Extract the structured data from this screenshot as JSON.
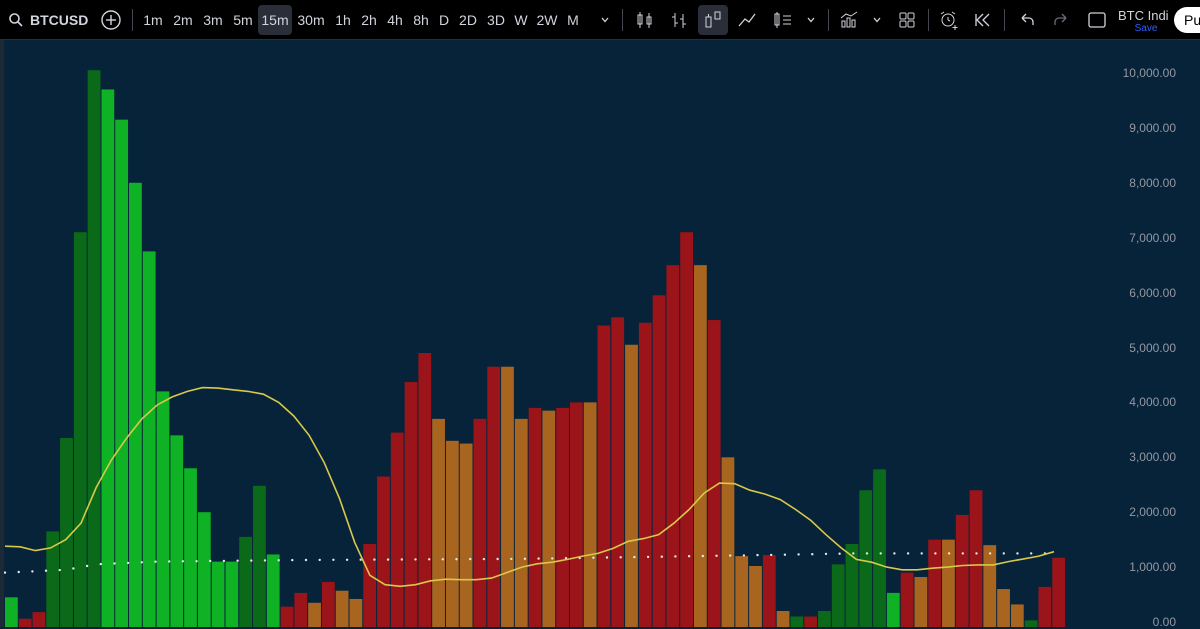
{
  "toolbar": {
    "symbol": "BTCUSD",
    "intervals": [
      "1m",
      "2m",
      "3m",
      "5m",
      "15m",
      "30m",
      "1h",
      "2h",
      "4h",
      "8h",
      "D",
      "2D",
      "3D",
      "W",
      "2W",
      "M"
    ],
    "active_interval": "15m",
    "layout_name": "BTC Indi",
    "save_status": "Save",
    "publish_label": "Pu"
  },
  "colors": {
    "background": "#06233a",
    "bright_green": "#0fb224",
    "dark_green": "#0b6a1a",
    "red": "#9b1419",
    "orange": "#a8651f",
    "ma_line": "#d8c94a",
    "dot_line": "#e8e8e8"
  },
  "chart_data": {
    "type": "bar",
    "ylim": [
      0,
      10000
    ],
    "y_ticks": [
      "10,000.00",
      "9,000.00",
      "8,000.00",
      "7,000.00",
      "6,000.00",
      "5,000.00",
      "4,000.00",
      "3,000.00",
      "2,000.00",
      "1,000.00",
      "0.00"
    ],
    "y_tick_values": [
      10000,
      9000,
      8000,
      7000,
      6000,
      5000,
      4000,
      3000,
      2000,
      1000,
      0
    ],
    "bars": [
      {
        "v": 450,
        "c": "bright_green"
      },
      {
        "v": 60,
        "c": "red"
      },
      {
        "v": 180,
        "c": "red"
      },
      {
        "v": 1650,
        "c": "dark_green"
      },
      {
        "v": 3350,
        "c": "dark_green"
      },
      {
        "v": 7100,
        "c": "dark_green"
      },
      {
        "v": 10050,
        "c": "dark_green"
      },
      {
        "v": 9700,
        "c": "bright_green"
      },
      {
        "v": 9150,
        "c": "bright_green"
      },
      {
        "v": 8000,
        "c": "bright_green"
      },
      {
        "v": 6750,
        "c": "bright_green"
      },
      {
        "v": 4200,
        "c": "bright_green"
      },
      {
        "v": 3400,
        "c": "bright_green"
      },
      {
        "v": 2800,
        "c": "bright_green"
      },
      {
        "v": 2000,
        "c": "bright_green"
      },
      {
        "v": 1100,
        "c": "bright_green"
      },
      {
        "v": 1100,
        "c": "bright_green"
      },
      {
        "v": 1550,
        "c": "dark_green"
      },
      {
        "v": 2480,
        "c": "dark_green"
      },
      {
        "v": 1230,
        "c": "bright_green"
      },
      {
        "v": 280,
        "c": "red"
      },
      {
        "v": 530,
        "c": "red"
      },
      {
        "v": 350,
        "c": "orange"
      },
      {
        "v": 730,
        "c": "red"
      },
      {
        "v": 570,
        "c": "orange"
      },
      {
        "v": 420,
        "c": "orange"
      },
      {
        "v": 1420,
        "c": "red"
      },
      {
        "v": 2650,
        "c": "red"
      },
      {
        "v": 3450,
        "c": "red"
      },
      {
        "v": 4370,
        "c": "red"
      },
      {
        "v": 4900,
        "c": "red"
      },
      {
        "v": 3700,
        "c": "orange"
      },
      {
        "v": 3300,
        "c": "orange"
      },
      {
        "v": 3250,
        "c": "orange"
      },
      {
        "v": 3700,
        "c": "red"
      },
      {
        "v": 4650,
        "c": "red"
      },
      {
        "v": 4650,
        "c": "orange"
      },
      {
        "v": 3700,
        "c": "orange"
      },
      {
        "v": 3900,
        "c": "red"
      },
      {
        "v": 3850,
        "c": "orange"
      },
      {
        "v": 3900,
        "c": "red"
      },
      {
        "v": 4000,
        "c": "red"
      },
      {
        "v": 4000,
        "c": "orange"
      },
      {
        "v": 5400,
        "c": "red"
      },
      {
        "v": 5550,
        "c": "red"
      },
      {
        "v": 5050,
        "c": "orange"
      },
      {
        "v": 5450,
        "c": "red"
      },
      {
        "v": 5950,
        "c": "red"
      },
      {
        "v": 6500,
        "c": "red"
      },
      {
        "v": 7100,
        "c": "red"
      },
      {
        "v": 6500,
        "c": "orange"
      },
      {
        "v": 5500,
        "c": "red"
      },
      {
        "v": 3000,
        "c": "orange"
      },
      {
        "v": 1200,
        "c": "orange"
      },
      {
        "v": 1020,
        "c": "orange"
      },
      {
        "v": 1220,
        "c": "red"
      },
      {
        "v": 200,
        "c": "orange"
      },
      {
        "v": 100,
        "c": "dark_green"
      },
      {
        "v": 100,
        "c": "red"
      },
      {
        "v": 200,
        "c": "dark_green"
      },
      {
        "v": 1050,
        "c": "dark_green"
      },
      {
        "v": 1420,
        "c": "dark_green"
      },
      {
        "v": 2400,
        "c": "dark_green"
      },
      {
        "v": 2780,
        "c": "dark_green"
      },
      {
        "v": 530,
        "c": "bright_green"
      },
      {
        "v": 900,
        "c": "red"
      },
      {
        "v": 820,
        "c": "orange"
      },
      {
        "v": 1500,
        "c": "red"
      },
      {
        "v": 1500,
        "c": "orange"
      },
      {
        "v": 1950,
        "c": "red"
      },
      {
        "v": 2400,
        "c": "red"
      },
      {
        "v": 1400,
        "c": "orange"
      },
      {
        "v": 600,
        "c": "orange"
      },
      {
        "v": 320,
        "c": "orange"
      },
      {
        "v": 30,
        "c": "dark_green"
      },
      {
        "v": 640,
        "c": "red"
      },
      {
        "v": 1170,
        "c": "red"
      }
    ],
    "ma_line": [
      {
        "x": 0,
        "v": 1380
      },
      {
        "x": 1,
        "v": 1370
      },
      {
        "x": 2,
        "v": 1300
      },
      {
        "x": 3,
        "v": 1350
      },
      {
        "x": 4,
        "v": 1500
      },
      {
        "x": 5,
        "v": 1800
      },
      {
        "x": 6,
        "v": 2450
      },
      {
        "x": 7,
        "v": 2950
      },
      {
        "x": 8,
        "v": 3350
      },
      {
        "x": 9,
        "v": 3700
      },
      {
        "x": 10,
        "v": 3950
      },
      {
        "x": 11,
        "v": 4100
      },
      {
        "x": 12,
        "v": 4200
      },
      {
        "x": 13,
        "v": 4270
      },
      {
        "x": 14,
        "v": 4260
      },
      {
        "x": 15,
        "v": 4230
      },
      {
        "x": 16,
        "v": 4200
      },
      {
        "x": 17,
        "v": 4150
      },
      {
        "x": 18,
        "v": 4000
      },
      {
        "x": 19,
        "v": 3750
      },
      {
        "x": 20,
        "v": 3400
      },
      {
        "x": 21,
        "v": 2900
      },
      {
        "x": 22,
        "v": 2250
      },
      {
        "x": 23,
        "v": 1450
      },
      {
        "x": 24,
        "v": 850
      },
      {
        "x": 25,
        "v": 680
      },
      {
        "x": 26,
        "v": 650
      },
      {
        "x": 27,
        "v": 680
      },
      {
        "x": 28,
        "v": 750
      },
      {
        "x": 29,
        "v": 780
      },
      {
        "x": 30,
        "v": 770
      },
      {
        "x": 31,
        "v": 770
      },
      {
        "x": 32,
        "v": 800
      },
      {
        "x": 33,
        "v": 900
      },
      {
        "x": 34,
        "v": 1000
      },
      {
        "x": 35,
        "v": 1060
      },
      {
        "x": 36,
        "v": 1090
      },
      {
        "x": 37,
        "v": 1140
      },
      {
        "x": 38,
        "v": 1200
      },
      {
        "x": 39,
        "v": 1250
      },
      {
        "x": 40,
        "v": 1340
      },
      {
        "x": 41,
        "v": 1470
      },
      {
        "x": 42,
        "v": 1520
      },
      {
        "x": 43,
        "v": 1590
      },
      {
        "x": 44,
        "v": 1800
      },
      {
        "x": 45,
        "v": 2050
      },
      {
        "x": 46,
        "v": 2350
      },
      {
        "x": 47,
        "v": 2530
      },
      {
        "x": 48,
        "v": 2520
      },
      {
        "x": 49,
        "v": 2400
      },
      {
        "x": 50,
        "v": 2330
      },
      {
        "x": 51,
        "v": 2230
      },
      {
        "x": 52,
        "v": 2050
      },
      {
        "x": 53,
        "v": 1850
      },
      {
        "x": 54,
        "v": 1590
      },
      {
        "x": 55,
        "v": 1350
      },
      {
        "x": 56,
        "v": 1140
      },
      {
        "x": 57,
        "v": 1090
      },
      {
        "x": 58,
        "v": 1000
      },
      {
        "x": 59,
        "v": 950
      },
      {
        "x": 60,
        "v": 950
      },
      {
        "x": 61,
        "v": 980
      },
      {
        "x": 62,
        "v": 1000
      },
      {
        "x": 63,
        "v": 1030
      },
      {
        "x": 64,
        "v": 1040
      },
      {
        "x": 65,
        "v": 1040
      },
      {
        "x": 66,
        "v": 1100
      },
      {
        "x": 67,
        "v": 1150
      },
      {
        "x": 68,
        "v": 1200
      },
      {
        "x": 69,
        "v": 1280
      }
    ],
    "dot_line": [
      {
        "x": 0,
        "v": 900
      },
      {
        "x": 4,
        "v": 950
      },
      {
        "x": 6,
        "v": 1050
      },
      {
        "x": 10,
        "v": 1100
      },
      {
        "x": 20,
        "v": 1130
      },
      {
        "x": 34,
        "v": 1150
      },
      {
        "x": 50,
        "v": 1220
      },
      {
        "x": 56,
        "v": 1250
      },
      {
        "x": 69,
        "v": 1250
      }
    ]
  }
}
